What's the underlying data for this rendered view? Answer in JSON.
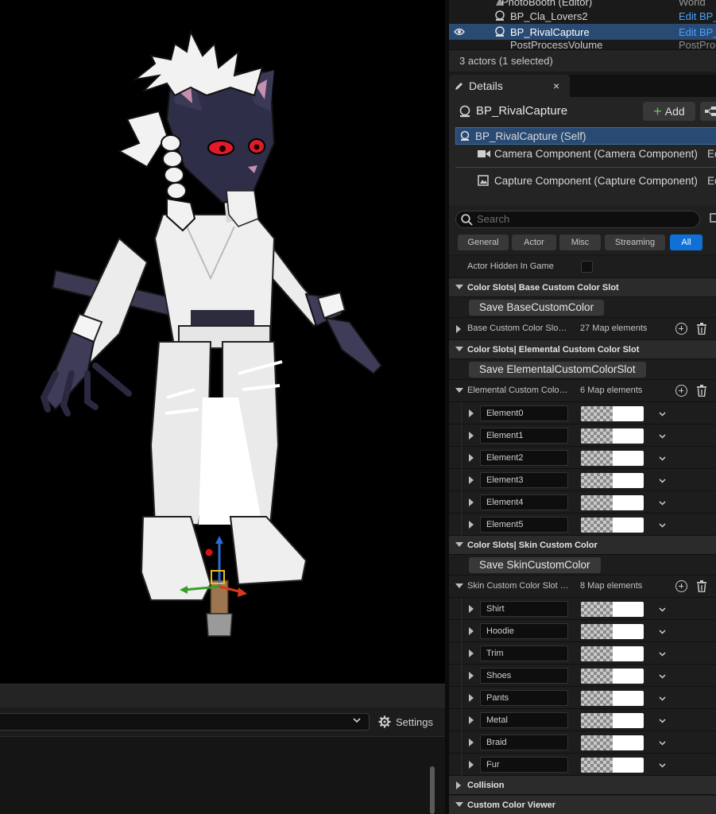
{
  "outliner": {
    "rows": [
      {
        "name": "PhotoBooth (Editor)",
        "type": "World"
      },
      {
        "name": "BP_Cla_Lovers2",
        "type": "Edit BP_"
      },
      {
        "name": "BP_RivalCapture",
        "type": "Edit BP_",
        "selected": true
      },
      {
        "name": "PostProcessVolume",
        "type": "PostProc"
      }
    ],
    "actor_count": "3 actors (1 selected)"
  },
  "details": {
    "tab_label": "Details",
    "tab_close": "×",
    "actor_name": "BP_RivalCapture",
    "add_label": "Add",
    "components": [
      {
        "label": "BP_RivalCapture (Self)",
        "edit": ""
      },
      {
        "label": "Camera Component (Camera Component)",
        "edit": "Ec"
      },
      {
        "label": "Capture Component (Capture Component)",
        "edit": "Ec"
      }
    ],
    "search_placeholder": "Search",
    "filters": [
      "General",
      "Actor",
      "Misc",
      "Streaming",
      "All"
    ],
    "active_filter": "All"
  },
  "properties": {
    "actor_hidden": {
      "label": "Actor Hidden In Game",
      "checked": false
    },
    "base_category": "Color Slots| Base Custom Color Slot",
    "base_save": "Save BaseCustomColor",
    "base_map": {
      "label": "Base Custom Color Slot D...",
      "count": "27 Map elements"
    },
    "elemental_category": "Color Slots| Elemental Custom Color Slot",
    "elemental_save": "Save ElementalCustomColorSlot",
    "elemental_map": {
      "label": "Elemental Custom Color Sl...",
      "count": "6 Map elements"
    },
    "elemental_entries": [
      "Element0",
      "Element1",
      "Element2",
      "Element3",
      "Element4",
      "Element5"
    ],
    "skin_category": "Color Slots| Skin Custom Color",
    "skin_save": "Save SkinCustomColor",
    "skin_map": {
      "label": "Skin Custom Color Slot De...",
      "count": "8 Map elements"
    },
    "skin_entries": [
      "Shirt",
      "Hoodie",
      "Trim",
      "Shoes",
      "Pants",
      "Metal",
      "Braid",
      "Fur"
    ],
    "collision_category": "Collision",
    "viewer_category": "Custom Color Viewer"
  },
  "viewport_bottom": {
    "settings_label": "Settings"
  },
  "colors": {
    "selection": "#294a73",
    "accent_blue": "#0f70d7",
    "link_blue": "#4ea3ff",
    "swatch_color": "#ffffff"
  }
}
